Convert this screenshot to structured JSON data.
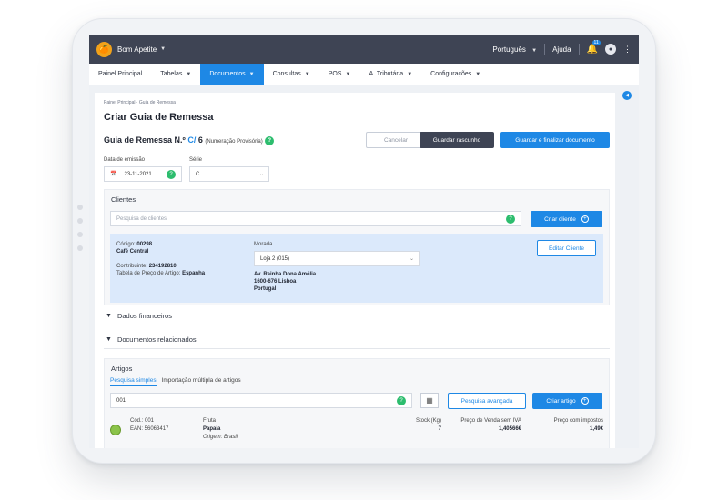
{
  "app": {
    "brand": "Bom Apetite",
    "language": "Português",
    "help": "Ajuda",
    "notif_count": "11"
  },
  "nav": [
    "Painel Principal",
    "Tabelas",
    "Documentos",
    "Consultas",
    "POS",
    "A. Tributária",
    "Configurações"
  ],
  "page": {
    "breadcrumb": "Painel Principal  ·  Guia de Remessa",
    "title": "Criar Guia de Remessa",
    "doc_label": "Guia de Remessa N.º",
    "doc_series": "C/",
    "doc_number": "6",
    "doc_note": "(Numeração Provisória)",
    "cancel": "Cancelar",
    "save_draft": "Guardar rascunho",
    "save_finalize": "Guardar e finalizar documento"
  },
  "date": {
    "label": "Data de emissão",
    "value": "23-11-2021"
  },
  "serie": {
    "label": "Série",
    "value": "C"
  },
  "clients": {
    "title": "Clientes",
    "search_placeholder": "Pesquisa de clientes",
    "create": "Criar cliente",
    "edit": "Editar Cliente",
    "code_label": "Código:",
    "code": "00298",
    "name": "Café Central",
    "nif_label": "Contribuinte:",
    "nif": "234192810",
    "price_label": "Tabela de Preço de Artigo:",
    "price": "Espanha",
    "address_label": "Morada",
    "address_select": "Loja 2 (015)",
    "addr1": "Av. Rainha Dona Amélia",
    "addr2": "1600-676 Lisboa",
    "addr3": "Portugal"
  },
  "financial": "Dados financeiros",
  "related": "Documentos relacionados",
  "articles": {
    "title": "Artigos",
    "tab_simple": "Pesquisa simples",
    "tab_multi": "Importação múltipla de artigos",
    "search_value": "001",
    "advanced": "Pesquisa avançada",
    "create": "Criar artigo",
    "row": {
      "code": "Cód.: 001",
      "ean": "EAN: 56063417",
      "category": "Fruta",
      "name": "Papaia",
      "origin": "Origem: Brasil",
      "stock_label": "Stock (Kg)",
      "stock": "7",
      "price_label": "Preço de Venda sem IVA",
      "price": "1,40566€",
      "tax_label": "Preço com impostos",
      "tax_price": "1,49€"
    }
  },
  "colors": {
    "accent": "#1e88e5",
    "topbar": "#3e4454",
    "success": "#2dbd6e"
  }
}
